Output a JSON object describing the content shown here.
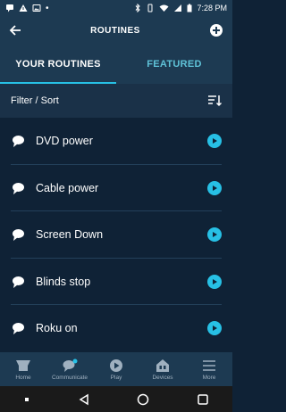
{
  "status_bar": {
    "time": "7:28 PM"
  },
  "header": {
    "title": "ROUTINES"
  },
  "tabs": [
    {
      "label": "YOUR ROUTINES",
      "active": true
    },
    {
      "label": "FEATURED",
      "active": false
    }
  ],
  "filter": {
    "label": "Filter / Sort"
  },
  "routines": [
    {
      "name": "DVD power"
    },
    {
      "name": "Cable power"
    },
    {
      "name": "Screen Down"
    },
    {
      "name": "Blinds stop"
    },
    {
      "name": "Roku on"
    }
  ],
  "nav": [
    {
      "label": "Home",
      "icon": "home-icon"
    },
    {
      "label": "Communicate",
      "icon": "communicate-icon"
    },
    {
      "label": "Play",
      "icon": "play-icon"
    },
    {
      "label": "Devices",
      "icon": "devices-icon"
    },
    {
      "label": "More",
      "icon": "more-icon"
    }
  ],
  "colors": {
    "accent": "#27c0e5",
    "header_bg": "#1d3a52",
    "page_bg": "#0f2236"
  }
}
